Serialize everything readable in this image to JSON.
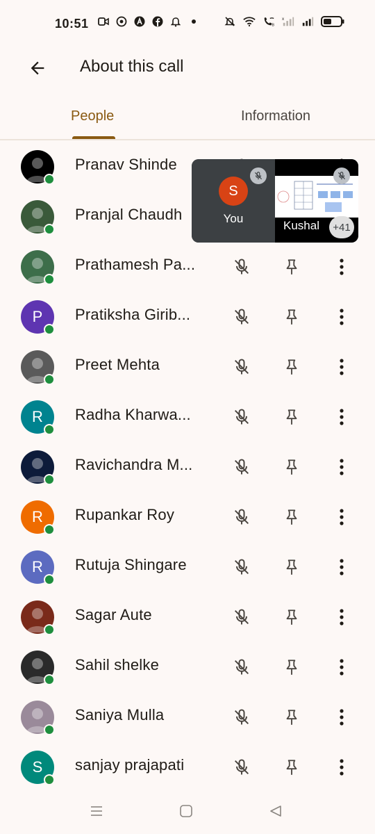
{
  "status_bar": {
    "time": "10:51",
    "left_icons": [
      "video-icon",
      "whatsapp-icon",
      "app-a-icon",
      "facebook-icon",
      "bell-icon",
      "dot-icon"
    ],
    "right_icons": [
      "mute-bell-icon",
      "wifi-icon",
      "wifi-calling-icon",
      "signal-icon",
      "signal-icon",
      "battery-icon"
    ]
  },
  "header": {
    "title": "About this call"
  },
  "tabs": [
    {
      "label": "People",
      "active": true
    },
    {
      "label": "Information",
      "active": false
    }
  ],
  "participants": [
    {
      "name": "Pranav Shinde",
      "avatar": "photo",
      "avatar_color": "#000000"
    },
    {
      "name": "Pranjal Chaudh",
      "avatar": "photo",
      "avatar_color": "#3a5a3a"
    },
    {
      "name": "Prathamesh Pa...",
      "avatar": "photo",
      "avatar_color": "#3d6e4a"
    },
    {
      "name": "Pratiksha Girib...",
      "avatar": "P",
      "avatar_color": "#5e35b1"
    },
    {
      "name": "Preet Mehta",
      "avatar": "photo",
      "avatar_color": "#5a5a5a"
    },
    {
      "name": "Radha Kharwa...",
      "avatar": "R",
      "avatar_color": "#00838f"
    },
    {
      "name": "Ravichandra M...",
      "avatar": "photo",
      "avatar_color": "#0d1b3a"
    },
    {
      "name": "Rupankar Roy",
      "avatar": "R",
      "avatar_color": "#ef6c00"
    },
    {
      "name": "Rutuja Shingare",
      "avatar": "R",
      "avatar_color": "#5c6bc0"
    },
    {
      "name": "Sagar Aute",
      "avatar": "photo",
      "avatar_color": "#7a2a1a"
    },
    {
      "name": "Sahil shelke",
      "avatar": "photo",
      "avatar_color": "#2a2a2a"
    },
    {
      "name": "Saniya Mulla",
      "avatar": "photo",
      "avatar_color": "#9a8a9a"
    },
    {
      "name": "sanjay prajapati",
      "avatar": "S",
      "avatar_color": "#00897b"
    }
  ],
  "pip": {
    "self_initial": "S",
    "self_label": "You",
    "presenter_label": "Kushal",
    "more_count": "+41"
  },
  "colors": {
    "accent": "#8a5a12",
    "online": "#1e8e3e",
    "background": "#fdf8f6"
  }
}
